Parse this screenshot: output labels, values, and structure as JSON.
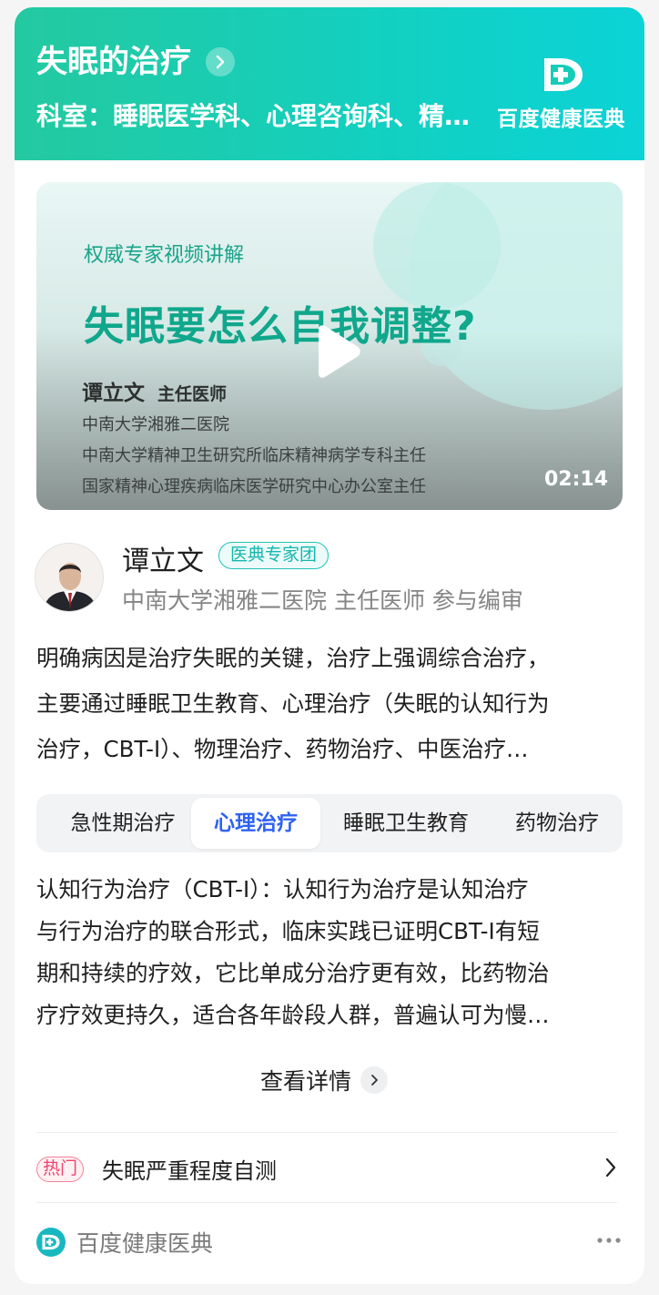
{
  "header": {
    "title": "失眠的治疗",
    "department": "科室：睡眠医学科、心理咨询科、精神科",
    "brand_name": "百度健康医典",
    "brand_icon": "health-cross-logo-icon"
  },
  "video": {
    "subtitle": "权威专家视频讲解",
    "title": "失眠要怎么自我调整?",
    "doctor_name": "谭立文",
    "doctor_title": "主任医师",
    "lines": [
      "中南大学湘雅二医院",
      "中南大学精神卫生研究所临床精神病学专科主任",
      "国家精神心理疾病临床医学研究中心办公室主任"
    ],
    "duration": "02:14",
    "play_icon": "play-icon"
  },
  "doctor": {
    "name": "谭立文",
    "badge": "医典专家团",
    "meta": "中南大学湘雅二医院 主任医师 参与编审"
  },
  "summary": [
    "明确病因是治疗失眠的关键，治疗上强调综合治疗，",
    "主要通过睡眠卫生教育、心理治疗（失眠的认知行为",
    "治疗，CBT-I）、物理治疗、药物治疗、中医治疗…"
  ],
  "tabs": [
    {
      "label": "急性期治疗"
    },
    {
      "label": "心理治疗"
    },
    {
      "label": "睡眠卫生教育"
    },
    {
      "label": "药物治疗"
    }
  ],
  "active_tab": "心理治疗",
  "tab_content": [
    "认知行为治疗（CBT-I）：认知行为治疗是认知治疗",
    "与行为治疗的联合形式，临床实践已证明CBT-I有短",
    "期和持续的疗效，它比单成分治疗更有效，比药物治",
    "疗疗效更持久，适合各年龄段人群，普遍认可为慢…"
  ],
  "more": {
    "label": "查看详情"
  },
  "hot": {
    "tag": "热门",
    "label": "失眠严重程度自测"
  },
  "footer": {
    "name": "百度健康医典",
    "more_icon": "more-dots-icon"
  },
  "colors": {
    "header_gradient_start": "#24c9a0",
    "header_gradient_end": "#0bd3d7",
    "active_tab": "#2f62f3",
    "badge": "#14b7ad",
    "hot": "#f1436b"
  }
}
